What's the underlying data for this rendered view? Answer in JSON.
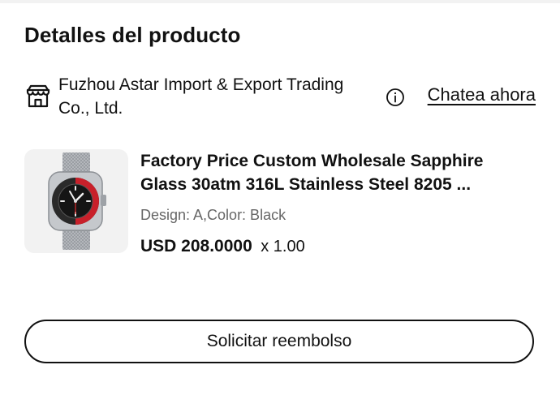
{
  "page": {
    "title": "Detalles del producto"
  },
  "seller": {
    "name": "Fuzhou Astar Import & Export Trading Co., Ltd.",
    "icon": "store-icon",
    "info_icon": "info-icon",
    "chat_label": "Chatea ahora"
  },
  "product": {
    "image_icon": "watch-image",
    "title": "Factory Price Custom Wholesale Sapphire Glass 30atm 316L Stainless Steel 8205 ...",
    "variant": "Design: A,Color: Black",
    "price": "USD 208.0000",
    "quantity": "x 1.00"
  },
  "actions": {
    "refund_label": "Solicitar reembolso"
  },
  "colors": {
    "text": "#111111",
    "muted": "#666666",
    "thumb_bg": "#f2f2f2",
    "watch_bezel_red": "#c8202a"
  }
}
